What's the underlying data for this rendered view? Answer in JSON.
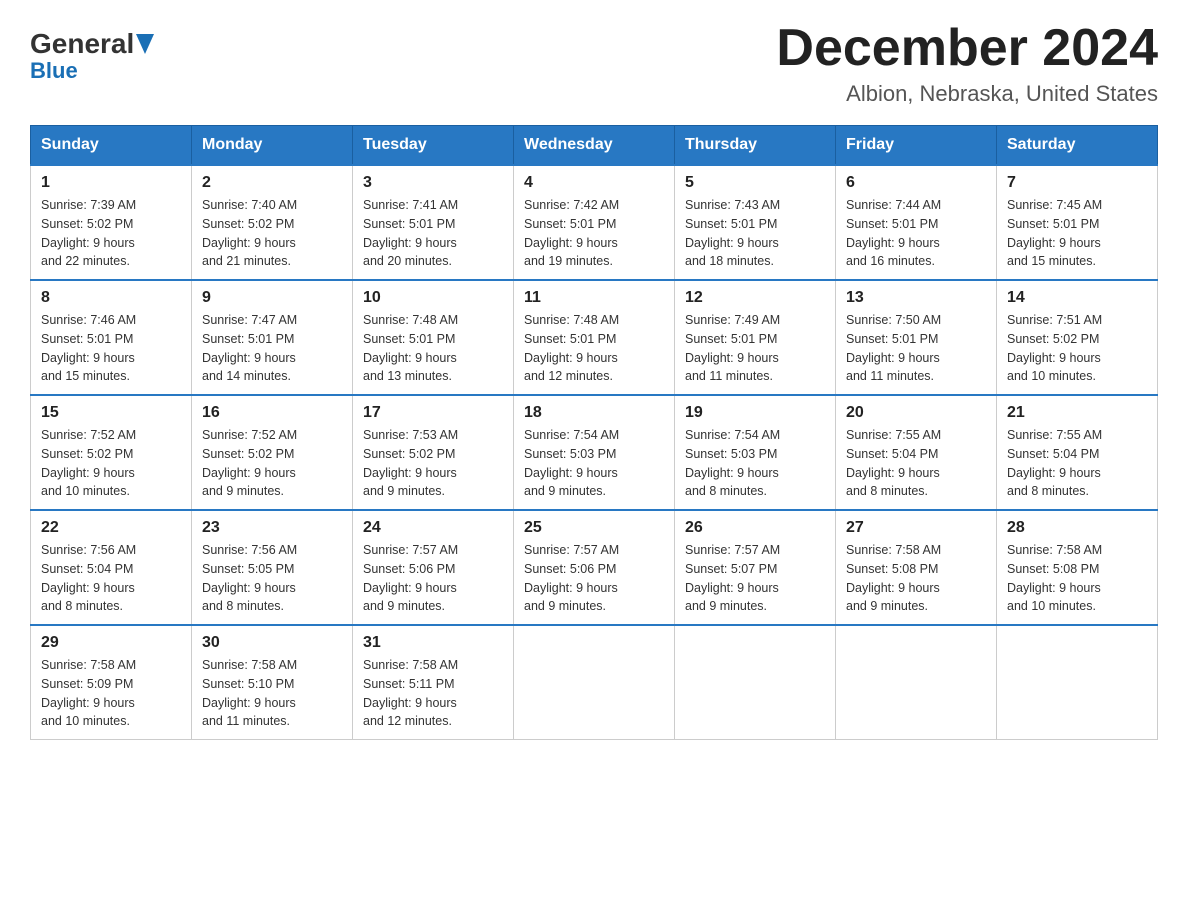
{
  "header": {
    "title": "December 2024",
    "subtitle": "Albion, Nebraska, United States",
    "logo_general": "General",
    "logo_blue": "Blue"
  },
  "weekdays": [
    "Sunday",
    "Monday",
    "Tuesday",
    "Wednesday",
    "Thursday",
    "Friday",
    "Saturday"
  ],
  "weeks": [
    [
      {
        "day": "1",
        "sunrise": "7:39 AM",
        "sunset": "5:02 PM",
        "daylight": "9 hours and 22 minutes."
      },
      {
        "day": "2",
        "sunrise": "7:40 AM",
        "sunset": "5:02 PM",
        "daylight": "9 hours and 21 minutes."
      },
      {
        "day": "3",
        "sunrise": "7:41 AM",
        "sunset": "5:01 PM",
        "daylight": "9 hours and 20 minutes."
      },
      {
        "day": "4",
        "sunrise": "7:42 AM",
        "sunset": "5:01 PM",
        "daylight": "9 hours and 19 minutes."
      },
      {
        "day": "5",
        "sunrise": "7:43 AM",
        "sunset": "5:01 PM",
        "daylight": "9 hours and 18 minutes."
      },
      {
        "day": "6",
        "sunrise": "7:44 AM",
        "sunset": "5:01 PM",
        "daylight": "9 hours and 16 minutes."
      },
      {
        "day": "7",
        "sunrise": "7:45 AM",
        "sunset": "5:01 PM",
        "daylight": "9 hours and 15 minutes."
      }
    ],
    [
      {
        "day": "8",
        "sunrise": "7:46 AM",
        "sunset": "5:01 PM",
        "daylight": "9 hours and 15 minutes."
      },
      {
        "day": "9",
        "sunrise": "7:47 AM",
        "sunset": "5:01 PM",
        "daylight": "9 hours and 14 minutes."
      },
      {
        "day": "10",
        "sunrise": "7:48 AM",
        "sunset": "5:01 PM",
        "daylight": "9 hours and 13 minutes."
      },
      {
        "day": "11",
        "sunrise": "7:48 AM",
        "sunset": "5:01 PM",
        "daylight": "9 hours and 12 minutes."
      },
      {
        "day": "12",
        "sunrise": "7:49 AM",
        "sunset": "5:01 PM",
        "daylight": "9 hours and 11 minutes."
      },
      {
        "day": "13",
        "sunrise": "7:50 AM",
        "sunset": "5:01 PM",
        "daylight": "9 hours and 11 minutes."
      },
      {
        "day": "14",
        "sunrise": "7:51 AM",
        "sunset": "5:02 PM",
        "daylight": "9 hours and 10 minutes."
      }
    ],
    [
      {
        "day": "15",
        "sunrise": "7:52 AM",
        "sunset": "5:02 PM",
        "daylight": "9 hours and 10 minutes."
      },
      {
        "day": "16",
        "sunrise": "7:52 AM",
        "sunset": "5:02 PM",
        "daylight": "9 hours and 9 minutes."
      },
      {
        "day": "17",
        "sunrise": "7:53 AM",
        "sunset": "5:02 PM",
        "daylight": "9 hours and 9 minutes."
      },
      {
        "day": "18",
        "sunrise": "7:54 AM",
        "sunset": "5:03 PM",
        "daylight": "9 hours and 9 minutes."
      },
      {
        "day": "19",
        "sunrise": "7:54 AM",
        "sunset": "5:03 PM",
        "daylight": "9 hours and 8 minutes."
      },
      {
        "day": "20",
        "sunrise": "7:55 AM",
        "sunset": "5:04 PM",
        "daylight": "9 hours and 8 minutes."
      },
      {
        "day": "21",
        "sunrise": "7:55 AM",
        "sunset": "5:04 PM",
        "daylight": "9 hours and 8 minutes."
      }
    ],
    [
      {
        "day": "22",
        "sunrise": "7:56 AM",
        "sunset": "5:04 PM",
        "daylight": "9 hours and 8 minutes."
      },
      {
        "day": "23",
        "sunrise": "7:56 AM",
        "sunset": "5:05 PM",
        "daylight": "9 hours and 8 minutes."
      },
      {
        "day": "24",
        "sunrise": "7:57 AM",
        "sunset": "5:06 PM",
        "daylight": "9 hours and 9 minutes."
      },
      {
        "day": "25",
        "sunrise": "7:57 AM",
        "sunset": "5:06 PM",
        "daylight": "9 hours and 9 minutes."
      },
      {
        "day": "26",
        "sunrise": "7:57 AM",
        "sunset": "5:07 PM",
        "daylight": "9 hours and 9 minutes."
      },
      {
        "day": "27",
        "sunrise": "7:58 AM",
        "sunset": "5:08 PM",
        "daylight": "9 hours and 9 minutes."
      },
      {
        "day": "28",
        "sunrise": "7:58 AM",
        "sunset": "5:08 PM",
        "daylight": "9 hours and 10 minutes."
      }
    ],
    [
      {
        "day": "29",
        "sunrise": "7:58 AM",
        "sunset": "5:09 PM",
        "daylight": "9 hours and 10 minutes."
      },
      {
        "day": "30",
        "sunrise": "7:58 AM",
        "sunset": "5:10 PM",
        "daylight": "9 hours and 11 minutes."
      },
      {
        "day": "31",
        "sunrise": "7:58 AM",
        "sunset": "5:11 PM",
        "daylight": "9 hours and 12 minutes."
      },
      null,
      null,
      null,
      null
    ]
  ],
  "labels": {
    "sunrise": "Sunrise:",
    "sunset": "Sunset:",
    "daylight": "Daylight:"
  }
}
